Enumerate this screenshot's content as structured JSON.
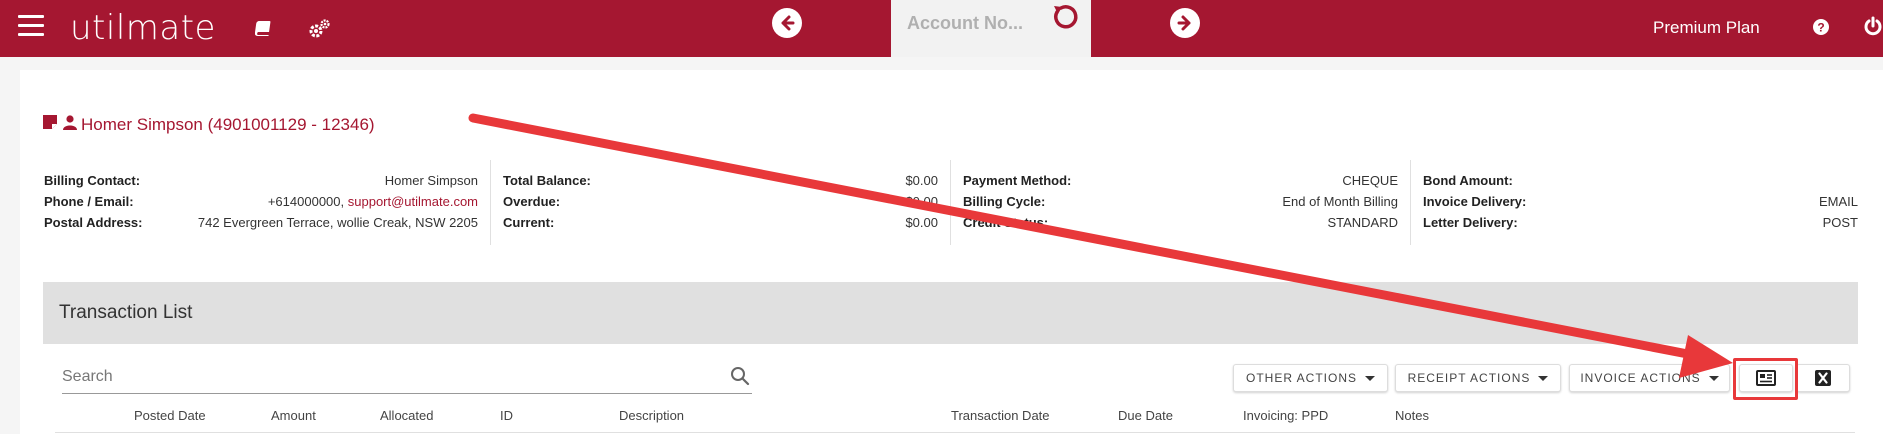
{
  "app": {
    "logo": "utilmate",
    "plan": "Premium Plan"
  },
  "account_search": {
    "placeholder": "Account No..."
  },
  "customer": {
    "title": "Homer Simpson (4901001129 - 12346)"
  },
  "info": {
    "col1": [
      {
        "label": "Billing Contact:",
        "value": "Homer Simpson"
      },
      {
        "label": "Phone / Email:",
        "value": "+614000000,",
        "email": "support@utilmate.com"
      },
      {
        "label": "Postal Address:",
        "value": "742 Evergreen Terrace, wollie Creak, NSW 2205"
      }
    ],
    "col2": [
      {
        "label": "Total Balance:",
        "value": "$0.00"
      },
      {
        "label": "Overdue:",
        "value": "$0.00"
      },
      {
        "label": "Current:",
        "value": "$0.00"
      }
    ],
    "col3": [
      {
        "label": "Payment Method:",
        "value": "CHEQUE"
      },
      {
        "label": "Billing Cycle:",
        "value": "End of Month Billing"
      },
      {
        "label": "Credit Status:",
        "value": "STANDARD"
      }
    ],
    "col4": [
      {
        "label": "Bond Amount:",
        "value": ""
      },
      {
        "label": "Invoice Delivery:",
        "value": "EMAIL"
      },
      {
        "label": "Letter Delivery:",
        "value": "POST"
      }
    ]
  },
  "transactions": {
    "title": "Transaction List",
    "search_placeholder": "Search",
    "actions": {
      "other": "OTHER ACTIONS",
      "receipt": "RECEIPT ACTIONS",
      "invoice": "INVOICE ACTIONS"
    },
    "columns": [
      "Posted Date",
      "Amount",
      "Allocated",
      "ID",
      "Description",
      "Transaction Date",
      "Due Date",
      "Invoicing: PPD",
      "Notes"
    ]
  },
  "colors": {
    "brand": "#a51731",
    "highlight": "#e8383a",
    "header_bg": "#e0e0e0"
  }
}
